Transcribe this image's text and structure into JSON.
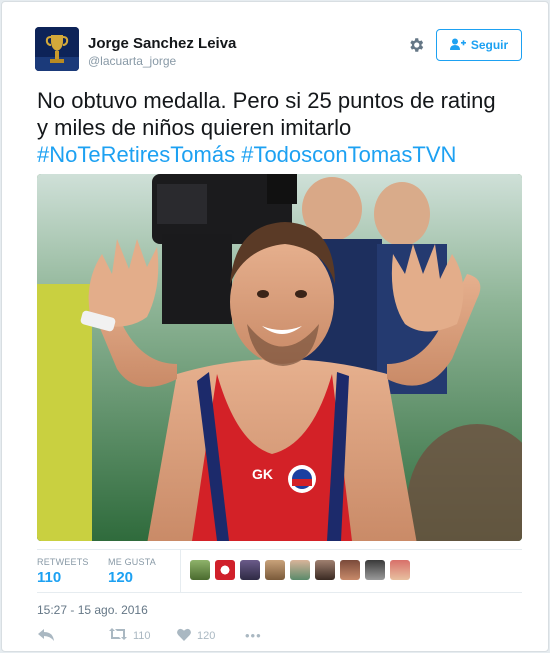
{
  "user": {
    "name": "Jorge Sanchez Leiva",
    "handle": "@lacuarta_jorge"
  },
  "header": {
    "follow_label": "Seguir"
  },
  "tweet": {
    "line1": "No obtuvo medalla. Pero si 25 puntos de rating",
    "line2": "y miles de niños quieren imitarlo",
    "hashtag1": "#NoTeRetiresTomás",
    "hashtag2": "#TodosconTomasTVN"
  },
  "stats": {
    "retweets_label": "RETWEETS",
    "retweets_value": "110",
    "likes_label": "ME GUSTA",
    "likes_value": "120"
  },
  "timestamp": "15:27 - 15 ago. 2016",
  "actions": {
    "reply_icon": "reply-icon",
    "retweet_count": "110",
    "like_count": "120",
    "more_label": "•••"
  },
  "colors": {
    "accent": "#1da1f2",
    "muted": "#8899a6"
  }
}
